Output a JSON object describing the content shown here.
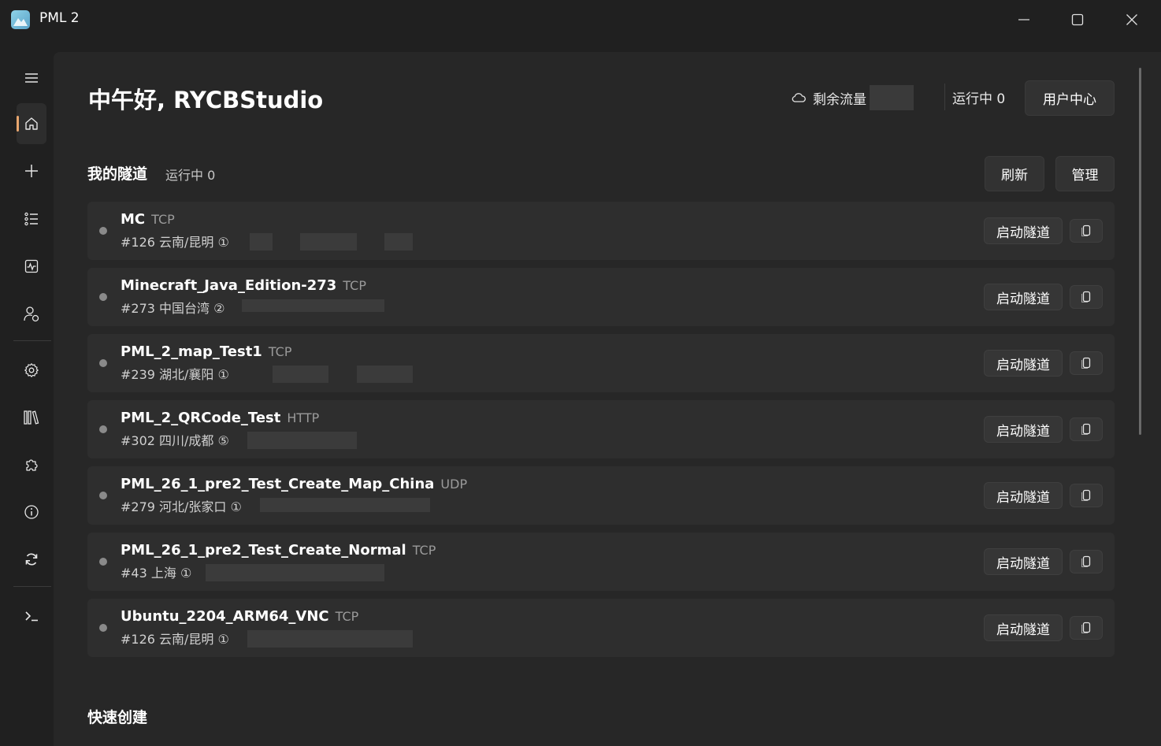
{
  "window": {
    "title": "PML 2"
  },
  "header": {
    "greeting": "中午好, RYCBStudio",
    "traffic_label": "剩余流量",
    "running_label": "运行中 0",
    "user_center_label": "用户中心"
  },
  "tunnels_section": {
    "title": "我的隧道",
    "running": "运行中 0",
    "refresh_label": "刷新",
    "manage_label": "管理"
  },
  "tunnels": [
    {
      "name": "MC",
      "protocol": "TCP",
      "info": "#126 云南/昆明 ①",
      "start_label": "启动隧道"
    },
    {
      "name": "Minecraft_Java_Edition-273",
      "protocol": "TCP",
      "info": "#273 中国台湾 ②",
      "start_label": "启动隧道"
    },
    {
      "name": "PML_2_map_Test1",
      "protocol": "TCP",
      "info": "#239 湖北/襄阳 ①",
      "start_label": "启动隧道"
    },
    {
      "name": "PML_2_QRCode_Test",
      "protocol": "HTTP",
      "info": "#302 四川/成都 ⑤",
      "start_label": "启动隧道"
    },
    {
      "name": "PML_26_1_pre2_Test_Create_Map_China",
      "protocol": "UDP",
      "info": "#279 河北/张家口 ①",
      "start_label": "启动隧道"
    },
    {
      "name": "PML_26_1_pre2_Test_Create_Normal",
      "protocol": "TCP",
      "info": "#43 上海 ①",
      "start_label": "启动隧道"
    },
    {
      "name": "Ubuntu_2204_ARM64_VNC",
      "protocol": "TCP",
      "info": "#126 云南/昆明 ①",
      "start_label": "启动隧道"
    }
  ],
  "quick_create": {
    "title": "快速创建"
  },
  "icons": {
    "menu": "hamburger-icon",
    "home": "home-icon",
    "add": "plus-icon",
    "list": "list-icon",
    "monitor": "activity-icon",
    "user": "user-settings-icon",
    "settings": "gear-icon",
    "library": "library-icon",
    "plugin": "puzzle-icon",
    "info": "info-icon",
    "update": "refresh-icon",
    "terminal": "terminal-icon",
    "copy": "copy-icon",
    "cloud": "cloud-icon"
  },
  "colors": {
    "accent": "#e8a66e",
    "background": "#202020",
    "card": "#2e2e2e"
  }
}
